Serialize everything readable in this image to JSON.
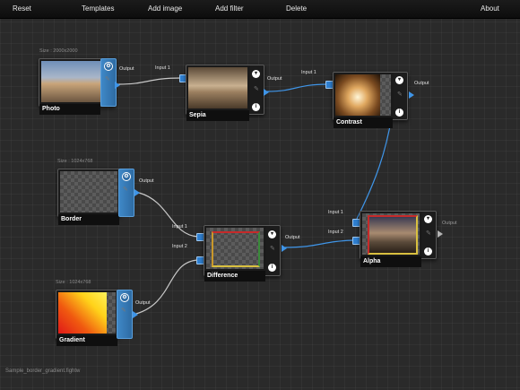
{
  "toolbar": {
    "reset": "Reset",
    "templates": "Templates",
    "add_image": "Add image",
    "add_filter": "Add filter",
    "delete": "Delete",
    "about": "About"
  },
  "nodes": {
    "photo": {
      "label": "Photo",
      "size": "Size : 2000x2000",
      "output": "Output"
    },
    "sepia": {
      "label": "Sepia",
      "input1": "Input 1",
      "output": "Output"
    },
    "contrast": {
      "label": "Contrast",
      "input1": "Input 1",
      "output": "Output"
    },
    "border": {
      "label": "Border",
      "size": "Size : 1024x768",
      "output": "Output"
    },
    "difference": {
      "label": "Difference",
      "input1": "Input 1",
      "input2": "Input 2",
      "output": "Output"
    },
    "gradient": {
      "label": "Gradient",
      "size": "Size : 1024x768",
      "output": "Output"
    },
    "alpha": {
      "label": "Alpha",
      "input1": "Input 1",
      "input2": "Input 2",
      "output": "Output"
    }
  },
  "filename": "Sample_border_gradient.fightw",
  "colors": {
    "wire": "#3f95e8",
    "wire_grey": "#c8c8c8",
    "source_panel": "#3f88c7"
  },
  "icons": {
    "source_settings": "gear-icon",
    "filter_menu": "chevron-down-icon",
    "filter_info": "info-icon",
    "edit": "pencil-icon"
  }
}
